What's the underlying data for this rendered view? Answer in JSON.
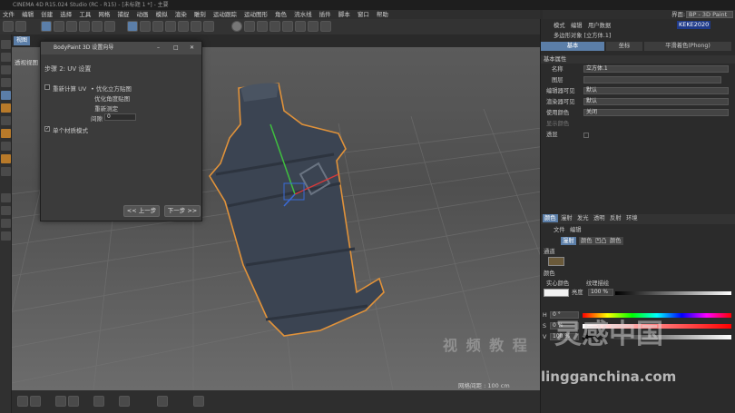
{
  "window": {
    "title": "CINEMA 4D R15.024 Studio (RC - R15) - [未标题 1 *] - 主要"
  },
  "menu": [
    "文件",
    "编辑",
    "创建",
    "选择",
    "工具",
    "网格",
    "捕捉",
    "动画",
    "模拟",
    "渲染",
    "雕刻",
    "运动跟踪",
    "运动图形",
    "角色",
    "流水线",
    "插件",
    "脚本",
    "窗口",
    "帮助"
  ],
  "layout": {
    "label": "界面:",
    "value": "BP - 3D Paint"
  },
  "viewport": {
    "tabs": [
      "视图"
    ],
    "camera": "透视视图",
    "grid_info": "网格间距 : 100 cm"
  },
  "dialog": {
    "title": "BodyPaint 3D 设置向导",
    "step": "步骤 2: UV 设置",
    "recalc_uv": "重新计算 UV",
    "opt_cube": "优化立方贴图",
    "opt_angle": "优化角度贴图",
    "realign": "重新测定",
    "spacing_label": "间隙",
    "spacing_value": "0",
    "single_material": "单个材质模式",
    "prev": "<< 上一步",
    "next": "下一步 >>"
  },
  "attributes": {
    "menu": [
      "模式",
      "编辑",
      "用户数据"
    ],
    "object": "多边形对象 [立方体.1]",
    "tabs": [
      "基本",
      "坐标",
      "平滑着色(Phong)"
    ],
    "section": "基本属性",
    "rows": [
      {
        "label": "名称",
        "value": "立方体.1"
      },
      {
        "label": "图层",
        "value": ""
      },
      {
        "label": "编辑器可见",
        "value": "默认"
      },
      {
        "label": "渲染器可见",
        "value": "默认"
      },
      {
        "label": "使用颜色",
        "value": "关闭"
      },
      {
        "label": "显示颜色",
        "value": ""
      },
      {
        "label": "透显",
        "value": ""
      }
    ],
    "badge": "KEKE2020"
  },
  "material": {
    "tabs": [
      "颜色",
      "漫射",
      "发光",
      "透明",
      "反射",
      "环境",
      "烟雾",
      "凹凸",
      "法线",
      "Alpha"
    ],
    "menu": [
      "文件",
      "编辑"
    ],
    "channels": [
      "漫射",
      "颜色",
      "凹凸",
      "颜色"
    ],
    "section": "通道",
    "color_label": "颜色",
    "solid": "实心颜色",
    "texture": "纹理描绘",
    "brightness_label": "亮度",
    "brightness_value": "100 %",
    "h_label": "H",
    "h_value": "0 °",
    "s_label": "S",
    "s_value": "0 %",
    "v_label": "V",
    "v_value": "100 %"
  },
  "watermarks": [
    "视 频 教 程",
    "lingganchina.com",
    "灵感中国"
  ],
  "colors": {
    "accent": "#5b7ea8",
    "model": "#3b4452",
    "outline": "#e0923a",
    "panel": "#2b2b2b"
  }
}
